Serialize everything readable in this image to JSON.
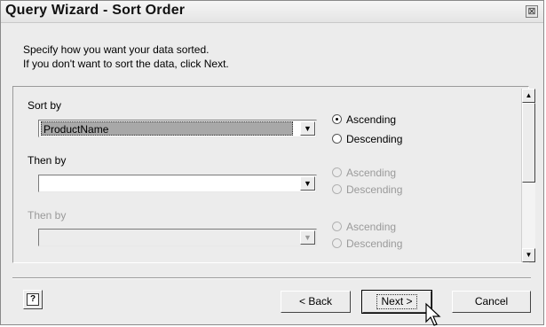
{
  "window": {
    "title": "Query Wizard - Sort Order",
    "close_glyph": "⊠"
  },
  "instructions": {
    "line1": "Specify how you want your data sorted.",
    "line2": "If you don't want to sort the data, click Next."
  },
  "sort_levels": [
    {
      "label": "Sort by",
      "field_value": "ProductName",
      "enabled": true,
      "selected_highlight": true,
      "ascending_label": "Ascending",
      "descending_label": "Descending",
      "selected_order": "Ascending"
    },
    {
      "label": "Then by",
      "field_value": "",
      "enabled": true,
      "ascending_label": "Ascending",
      "descending_label": "Descending",
      "selected_order": null,
      "order_enabled": false
    },
    {
      "label": "Then by",
      "field_value": "",
      "enabled": false,
      "ascending_label": "Ascending",
      "descending_label": "Descending",
      "selected_order": null,
      "order_enabled": false
    }
  ],
  "dropdown_glyph": "▼",
  "scrollbar": {
    "up_glyph": "▲",
    "down_glyph": "▼"
  },
  "footer": {
    "help_glyph": "?",
    "back_label": "< Back",
    "next_label": "Next >",
    "cancel_label": "Cancel"
  }
}
